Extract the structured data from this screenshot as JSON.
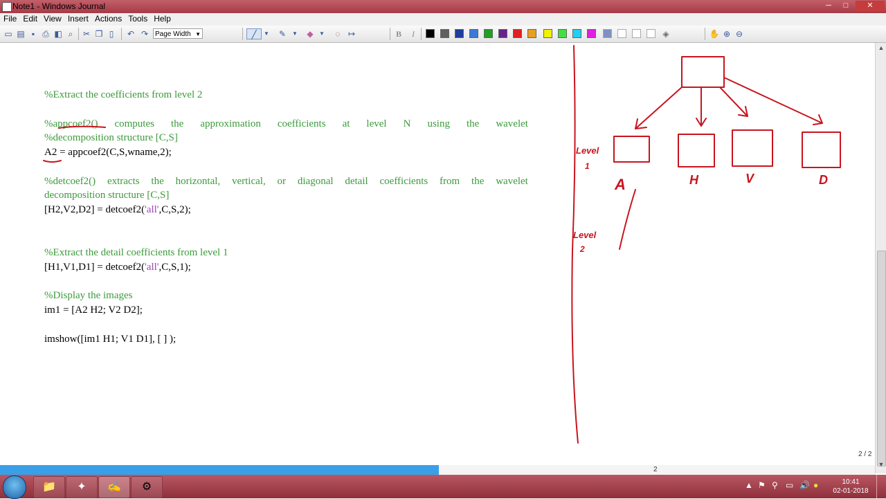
{
  "window": {
    "title": "Note1 - Windows Journal",
    "minimize": "─",
    "maximize": "□",
    "close": "✕"
  },
  "menu": [
    "File",
    "Edit",
    "View",
    "Insert",
    "Actions",
    "Tools",
    "Help"
  ],
  "toolbar": {
    "zoom_value": "Page Width",
    "bold_label": "B",
    "italic_label": "I",
    "pen_colors": [
      "#000000",
      "#606060",
      "#1e3c9c",
      "#3c78d8",
      "#20a020",
      "#6a2090",
      "#e02020",
      "#e8a020",
      "#f0f000",
      "#40e040",
      "#20d0f0",
      "#e020e0"
    ],
    "highlighter_colors": [
      "#8090c0",
      "#ffffff",
      "#ffffff",
      "#ffffff",
      "#ffffff"
    ]
  },
  "document": {
    "line1": "%Extract the coefficients from level 2",
    "line2_words": [
      "%appcoef2()",
      "computes",
      "the",
      "approximation",
      "coefficients",
      "at",
      "level",
      "N",
      "using",
      "the",
      "wavelet"
    ],
    "line3": "%decomposition structure [C,S]",
    "line4": "A2 = appcoef2(C,S,wname,2);",
    "line5_words": [
      "%detcoef2()",
      "extracts",
      "the",
      "horizontal,",
      "vertical,",
      "or",
      "diagonal",
      "detail",
      "coefficients",
      "from",
      "the",
      "wavelet"
    ],
    "line6": "decomposition structure [C,S]",
    "line7_before": "[H2,V2,D2] = detcoef2(",
    "line7_str": "'all'",
    "line7_after": ",C,S,2);",
    "line8": "%Extract the detail coefficients from level 1",
    "line9_before": "[H1,V1,D1] = detcoef2(",
    "line9_str": "'all'",
    "line9_after": ",C,S,1);",
    "line10": "%Display the images",
    "line11": "im1 = [A2 H2; V2 D2];",
    "line12": "imshow([im1 H1; V1 D1], [ ] );"
  },
  "ink": {
    "level1": "Level",
    "level1_num": "1",
    "level2": "Level",
    "level2_num": "2",
    "box_labels": [
      "A",
      "H",
      "V",
      "D"
    ],
    "color": "#c8141e"
  },
  "status": {
    "page_number": "2",
    "page_count": "2 / 2",
    "hscroll_progress": 0.495
  },
  "taskbar": {
    "time": "10:41",
    "date": "02-01-2018"
  }
}
